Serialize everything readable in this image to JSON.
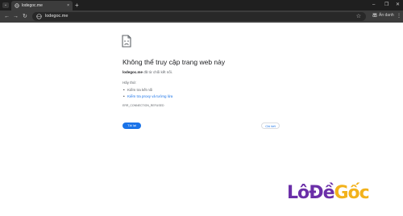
{
  "tab": {
    "title": "lodegoc.me",
    "close": "×",
    "new_tab": "+"
  },
  "window_controls": {
    "minimize": "–",
    "maximize": "❐",
    "close": "✕"
  },
  "toolbar": {
    "back": "←",
    "forward": "→",
    "reload": "↻",
    "url": "lodegoc.me",
    "star": "☆",
    "ext_label": "Ẩn danh",
    "menu": "⋮"
  },
  "icons": [
    "tab-search-icon",
    "globe-icon",
    "close-icon",
    "plus-icon",
    "back-arrow-icon",
    "forward-arrow-icon",
    "reload-icon",
    "site-info-icon",
    "star-icon",
    "incognito-icon",
    "menu-icon",
    "sad-document-icon"
  ],
  "error": {
    "title": "Không thể truy cập trang web này",
    "host": "lodegoc.me",
    "desc_suffix": " đã từ chối kết nối.",
    "try_label": "Hãy thử:",
    "suggestions": [
      "Kiểm tra kết nối",
      "Kiểm tra proxy và tường lửa"
    ],
    "code": "ERR_CONNECTION_REFUSED"
  },
  "buttons": {
    "reload": "Tải lại",
    "details": "Chi tiết"
  },
  "watermark": {
    "part1": "LôĐề",
    "part2": "Gốc"
  },
  "colors": {
    "accent": "#1a73e8",
    "tabbar": "#1f1f1f",
    "toolbar": "#3c3c3c",
    "brand": "#6b2fa8",
    "brand_accent": "#f2b21b"
  }
}
